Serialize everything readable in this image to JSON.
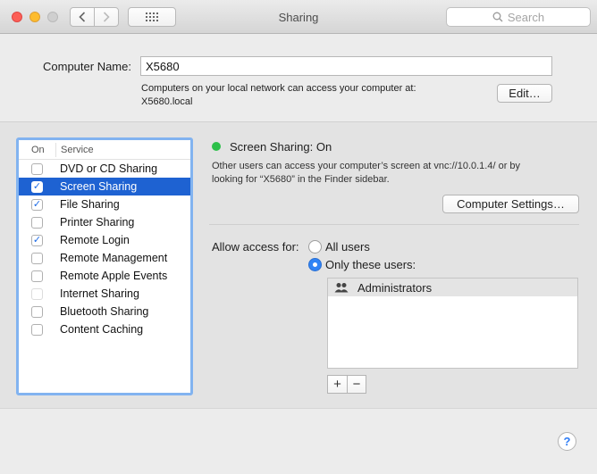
{
  "window": {
    "title": "Sharing",
    "search_placeholder": "Search",
    "grid_button_icon": "grid-icon"
  },
  "computer_name": {
    "label": "Computer Name:",
    "value": "X5680",
    "hint_line1": "Computers on your local network can access your computer at:",
    "hint_line2": "X5680.local",
    "edit_label": "Edit…"
  },
  "services": {
    "header_on": "On",
    "header_service": "Service",
    "items": [
      {
        "label": "DVD or CD Sharing",
        "checked": false,
        "selected": false
      },
      {
        "label": "Screen Sharing",
        "checked": true,
        "selected": true
      },
      {
        "label": "File Sharing",
        "checked": true,
        "selected": false
      },
      {
        "label": "Printer Sharing",
        "checked": false,
        "selected": false
      },
      {
        "label": "Remote Login",
        "checked": true,
        "selected": false
      },
      {
        "label": "Remote Management",
        "checked": false,
        "selected": false
      },
      {
        "label": "Remote Apple Events",
        "checked": false,
        "selected": false
      },
      {
        "label": "Internet Sharing",
        "checked": false,
        "selected": false,
        "disabled": true
      },
      {
        "label": "Bluetooth Sharing",
        "checked": false,
        "selected": false
      },
      {
        "label": "Content Caching",
        "checked": false,
        "selected": false
      }
    ]
  },
  "detail": {
    "status_title": "Screen Sharing: On",
    "status_color": "#2dc04a",
    "desc_line1": "Other users can access your computer’s screen at vnc://10.0.1.4/ or by",
    "desc_line2": "looking for “X5680” in the Finder sidebar.",
    "settings_label": "Computer Settings…",
    "access_label": "Allow access for:",
    "option_all": "All users",
    "option_only": "Only these users:",
    "selected_option": "only",
    "users": [
      "Administrators"
    ],
    "add_label": "+",
    "remove_label": "−"
  },
  "help_label": "?"
}
